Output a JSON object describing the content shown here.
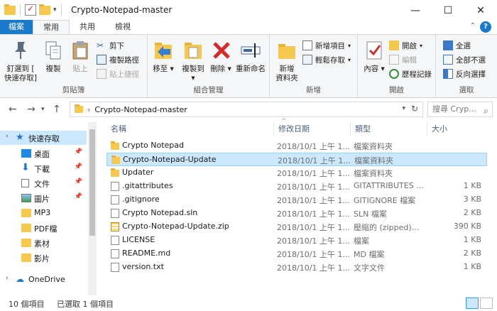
{
  "window": {
    "title": "Crypto-Notepad-master",
    "minimize": "—",
    "maximize": "☐",
    "close": "✕"
  },
  "ribbon_tabs": [
    "檔案",
    "常用",
    "共用",
    "檢視"
  ],
  "ribbon": {
    "clipboard": {
      "label": "剪貼簿",
      "pin": "釘選到 [\n快速存取]",
      "copy": "複製",
      "paste": "貼上",
      "cut": "剪下",
      "copy_path": "複製路徑",
      "paste_shortcut": "貼上捷徑"
    },
    "organize": {
      "label": "組合管理",
      "move_to": "移至",
      "copy_to": "複製到",
      "delete": "刪除",
      "rename": "重新命名"
    },
    "new": {
      "label": "新增",
      "new_folder": "新增\n資料夾",
      "new_item": "新增項目",
      "easy_access": "輕鬆存取"
    },
    "open": {
      "label": "開啟",
      "properties": "內容",
      "open": "開啟",
      "edit": "編輯",
      "history": "歷程記錄"
    },
    "select": {
      "label": "選取",
      "select_all": "全選",
      "select_none": "全部不選",
      "invert": "反向選擇"
    }
  },
  "address": {
    "path": "Crypto-Notepad-master",
    "search_placeholder": "搜尋 Cryp..."
  },
  "nav": [
    {
      "label": "快速存取",
      "pinned": false
    },
    {
      "label": "桌面",
      "pinned": true
    },
    {
      "label": "下載",
      "pinned": true
    },
    {
      "label": "文件",
      "pinned": true
    },
    {
      "label": "圖片",
      "pinned": true
    },
    {
      "label": "MP3",
      "pinned": false
    },
    {
      "label": "PDF檔",
      "pinned": false
    },
    {
      "label": "素材",
      "pinned": false
    },
    {
      "label": "影片",
      "pinned": false
    },
    {
      "label": "OneDrive",
      "pinned": false
    }
  ],
  "columns": {
    "name": "名稱",
    "date": "修改日期",
    "type": "類型",
    "size": "大小"
  },
  "files": [
    {
      "name": "Crypto Notepad",
      "date": "2018/10/1 上午 1...",
      "type": "檔案資料夾",
      "size": "",
      "kind": "folder"
    },
    {
      "name": "Crypto-Notepad-Update",
      "date": "2018/10/1 上午 1...",
      "type": "檔案資料夾",
      "size": "",
      "kind": "folder"
    },
    {
      "name": "Updater",
      "date": "2018/10/1 上午 1...",
      "type": "檔案資料夾",
      "size": "",
      "kind": "folder"
    },
    {
      "name": ".gitattributes",
      "date": "2018/10/1 上午 1...",
      "type": "GITATTRIBUTES ...",
      "size": "1 KB",
      "kind": "doc"
    },
    {
      "name": ".gitignore",
      "date": "2018/10/1 上午 1...",
      "type": "GITIGNORE 檔案",
      "size": "3 KB",
      "kind": "doc"
    },
    {
      "name": "Crypto Notepad.sln",
      "date": "2018/10/1 上午 1...",
      "type": "SLN 檔案",
      "size": "2 KB",
      "kind": "doc"
    },
    {
      "name": "Crypto-Notepad-Update.zip",
      "date": "2018/10/1 上午 1...",
      "type": "壓縮的 (zipped)...",
      "size": "390 KB",
      "kind": "zip"
    },
    {
      "name": "LICENSE",
      "date": "2018/10/1 上午 1...",
      "type": "檔案",
      "size": "1 KB",
      "kind": "doc"
    },
    {
      "name": "README.md",
      "date": "2018/10/1 上午 1...",
      "type": "MD 檔案",
      "size": "2 KB",
      "kind": "doc"
    },
    {
      "name": "version.txt",
      "date": "2018/10/1 上午 1...",
      "type": "文字文件",
      "size": "1 KB",
      "kind": "doc"
    }
  ],
  "selected_index": 1,
  "status": {
    "item_count": "10 個項目",
    "selected": "已選取 1 個項目"
  },
  "colors": {
    "accent": "#1979ca",
    "selection": "#cce8ff",
    "folder": "#f6c94e"
  }
}
